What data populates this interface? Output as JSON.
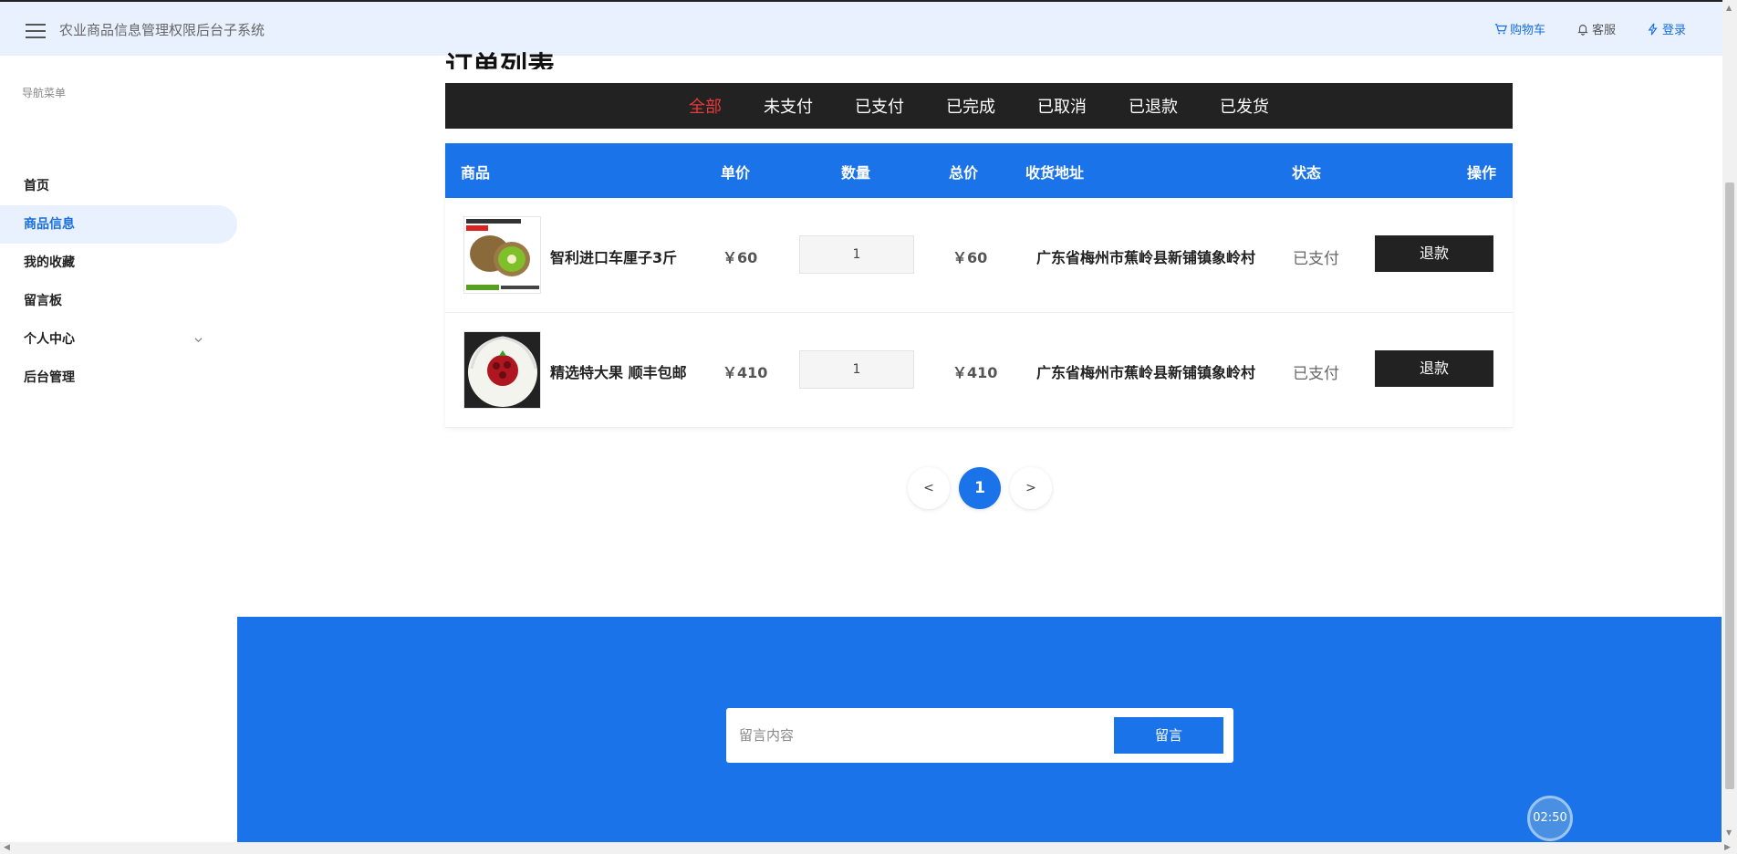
{
  "header": {
    "title": "农业商品信息管理权限后台子系统",
    "links": [
      {
        "label": "购物车",
        "icon": "cart-icon"
      },
      {
        "label": "客服",
        "icon": "bell-icon"
      },
      {
        "label": "登录",
        "icon": "lightning-icon"
      }
    ]
  },
  "sidebar": {
    "heading": "导航菜单",
    "items": [
      {
        "label": "首页"
      },
      {
        "label": "商品信息",
        "active": true
      },
      {
        "label": "我的收藏"
      },
      {
        "label": "留言板"
      },
      {
        "label": "个人中心",
        "has_children": true
      },
      {
        "label": "后台管理"
      }
    ]
  },
  "main": {
    "title": "订单列表",
    "tabs": [
      "全部",
      "未支付",
      "已支付",
      "已完成",
      "已取消",
      "已退款",
      "已发货"
    ],
    "active_tab": "全部",
    "table": {
      "headers": {
        "product": "商品",
        "unit_price": "单价",
        "quantity": "数量",
        "total": "总价",
        "address": "收货地址",
        "status": "状态",
        "action": "操作"
      },
      "rows": [
        {
          "name": "智利进口车厘子3斤",
          "unit_price": "￥60",
          "quantity": "1",
          "total": "￥60",
          "address": "广东省梅州市蕉岭县新铺镇象岭村",
          "status": "已支付",
          "action": "退款"
        },
        {
          "name": "精选特大果 顺丰包邮",
          "unit_price": "￥410",
          "quantity": "1",
          "total": "￥410",
          "address": "广东省梅州市蕉岭县新铺镇象岭村",
          "status": "已支付",
          "action": "退款"
        }
      ]
    },
    "pagination": {
      "prev": "<",
      "current": "1",
      "next": ">"
    }
  },
  "footer": {
    "message_placeholder": "留言内容",
    "message_button": "留言",
    "timer": "02:50"
  },
  "colors": {
    "primary": "#1a73e8",
    "header_bg": "#e8f1fd",
    "dark": "#222222",
    "active_tab": "#e8393c"
  }
}
